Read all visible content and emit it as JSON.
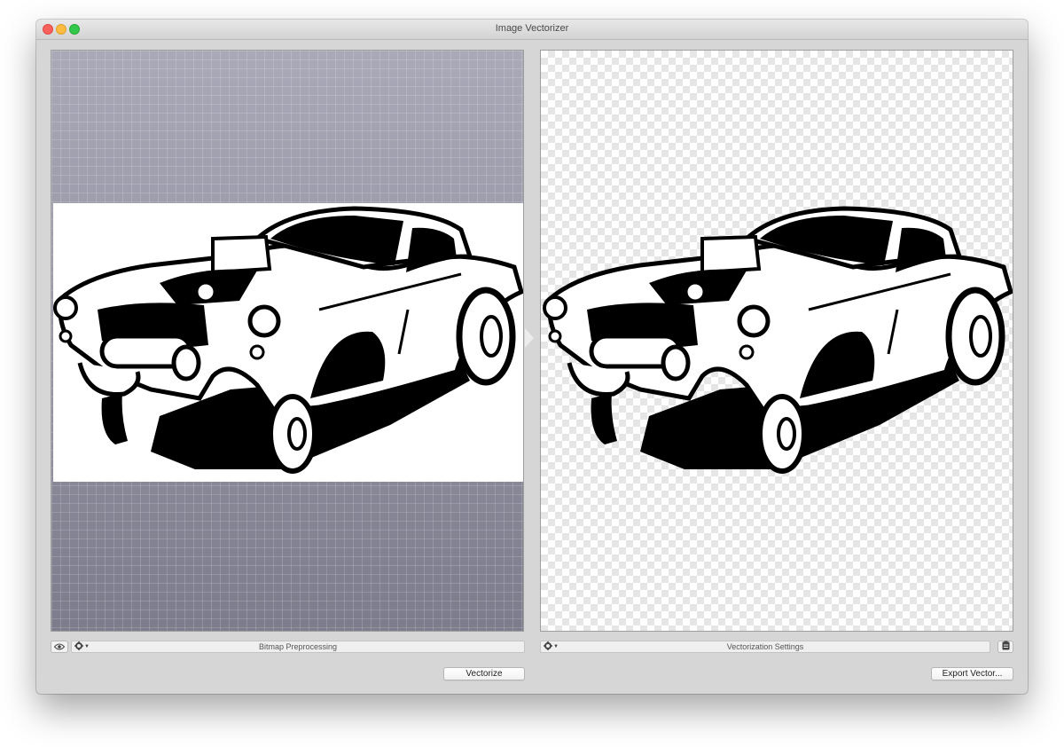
{
  "window": {
    "title": "Image Vectorizer"
  },
  "left_panel": {
    "toolbar_label": "Bitmap Preprocessing",
    "action_button": "Vectorize"
  },
  "right_panel": {
    "toolbar_label": "Vectorization Settings",
    "action_button": "Export Vector..."
  },
  "icons": [
    "eye-icon",
    "gear-icon",
    "clipboard-icon"
  ],
  "colors": {
    "window_bg": "#d6d6d6",
    "close": "#fc605c",
    "minimize": "#fdbc40",
    "zoom": "#34c84a",
    "left_canvas": "#9c9cac"
  }
}
